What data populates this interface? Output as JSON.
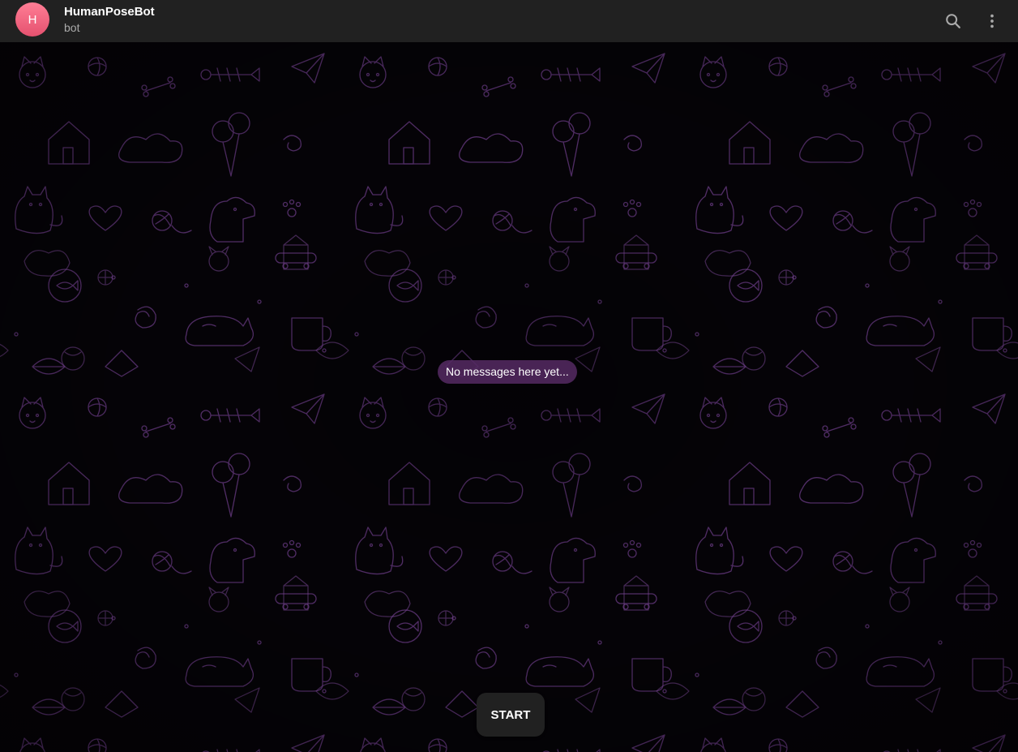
{
  "header": {
    "avatar_letter": "H",
    "title": "HumanPoseBot",
    "status": "bot",
    "search_icon": "search-icon",
    "more_icon": "more-vertical-icon"
  },
  "chat": {
    "empty_message": "No messages here yet...",
    "background_pattern": "doodle-pattern"
  },
  "footer": {
    "start_label": "START"
  },
  "colors": {
    "header_bg": "#212121",
    "avatar_gradient_top": "#ff7e95",
    "avatar_gradient_bottom": "#e5516f",
    "pattern_stroke": "#6a3a86",
    "badge_bg": "#562a64"
  }
}
